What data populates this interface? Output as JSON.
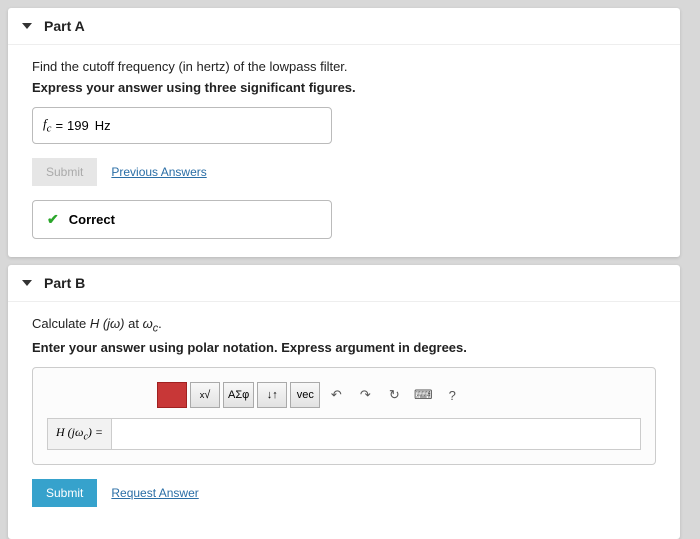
{
  "partA": {
    "title": "Part A",
    "question": "Find the cutoff frequency (in hertz) of the lowpass filter.",
    "instruction": "Express your answer using three significant figures.",
    "answer": {
      "var": "f",
      "sub": "c",
      "eq": "=",
      "value": "199",
      "unit": "Hz"
    },
    "submitLabel": "Submit",
    "prevAnswers": "Previous Answers",
    "correctLabel": "Correct"
  },
  "partB": {
    "title": "Part B",
    "question_pre": "Calculate ",
    "question_func": "H (jω)",
    "question_mid": " at ",
    "question_var": "ω",
    "question_sub": "c",
    "question_end": ".",
    "instruction": "Enter your answer using polar notation. Express argument in degrees.",
    "toolbar": {
      "templates": "",
      "sqrt": "√",
      "greek": "ΑΣφ",
      "updown": "↓↑",
      "vec": "vec",
      "undo": "↶",
      "redo": "↷",
      "reset": "↻",
      "keyboard": "⌨",
      "help": "?"
    },
    "eqLabel": "H (jω_c) =",
    "eqValue": "",
    "submitLabel": "Submit",
    "requestAnswer": "Request Answer"
  }
}
